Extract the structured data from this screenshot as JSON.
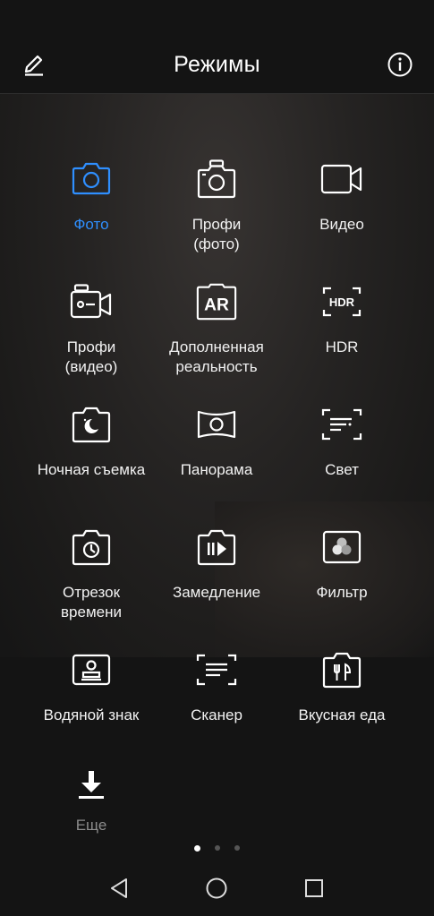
{
  "header": {
    "title": "Режимы"
  },
  "modes": [
    {
      "label": "Фото",
      "icon": "camera-icon",
      "active": true
    },
    {
      "label": "Профи\n(фото)",
      "icon": "pro-photo-icon"
    },
    {
      "label": "Видео",
      "icon": "video-camera-icon"
    },
    {
      "label": "Профи\n(видео)",
      "icon": "pro-video-icon"
    },
    {
      "label": "Дополненная\nреальность",
      "icon": "ar-icon"
    },
    {
      "label": "HDR",
      "icon": "hdr-icon"
    },
    {
      "label": "Ночная съемка",
      "icon": "night-mode-icon"
    },
    {
      "label": "Панорама",
      "icon": "panorama-icon"
    },
    {
      "label": "Свет",
      "icon": "light-painting-icon"
    },
    {
      "label": "Отрезок\nвремени",
      "icon": "time-lapse-icon"
    },
    {
      "label": "Замедление",
      "icon": "slow-motion-icon"
    },
    {
      "label": "Фильтр",
      "icon": "filter-icon"
    },
    {
      "label": "Водяной знак",
      "icon": "watermark-icon"
    },
    {
      "label": "Сканер",
      "icon": "scanner-icon"
    },
    {
      "label": "Вкусная еда",
      "icon": "food-icon"
    },
    {
      "label": "Еще",
      "icon": "download-icon",
      "dim": true
    }
  ],
  "colors": {
    "accent": "#2f8fff",
    "background": "#141414",
    "text": "#f2f2f2",
    "dim_text": "#8c8c8c"
  }
}
